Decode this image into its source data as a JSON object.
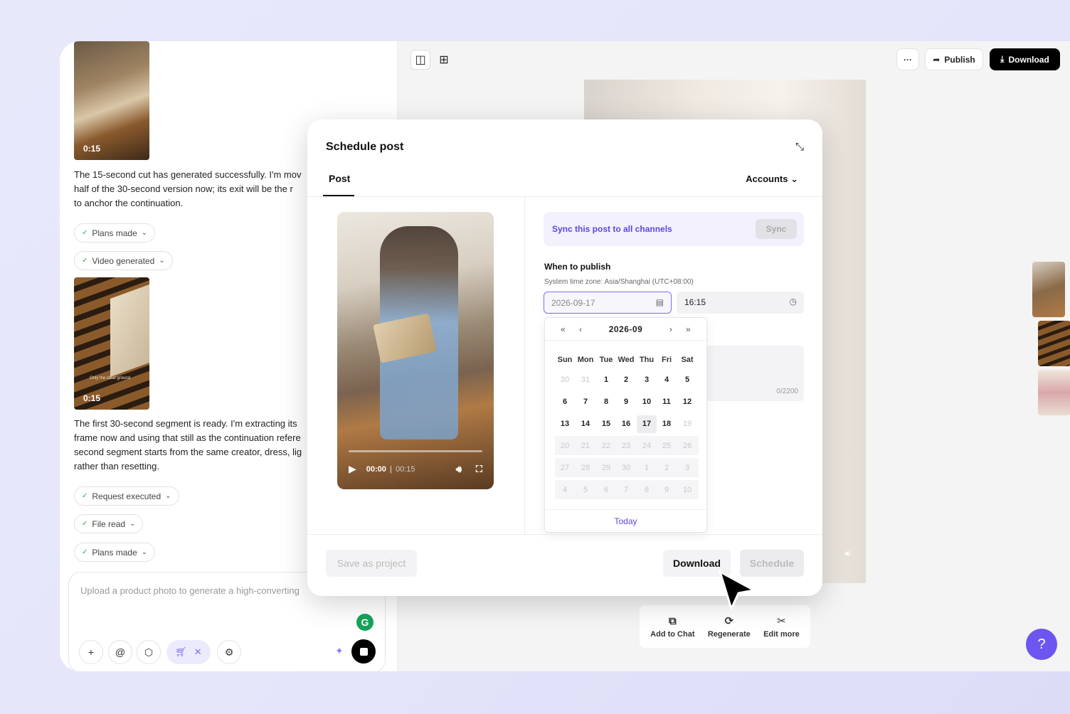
{
  "chat": {
    "thumb1_duration": "0:15",
    "para1": "The 15-second cut has generated successfully. I'm mov\nhalf of the 30-second version now; its exit will be the r\nto anchor the continuation.",
    "chip_plans_made": "Plans made",
    "chip_video_generated": "Video generated",
    "thumb2_caption": "Only the ideal ground",
    "thumb2_duration": "0:15",
    "para2": "The first 30-second segment is ready. I'm extracting its\nframe now and using that still as the continuation refere\nsecond segment starts from the same creator, dress, lig\nrather than resetting.",
    "chip_request_executed": "Request executed",
    "chip_file_read": "File read",
    "chip_plans_made_2": "Plans made",
    "composer_placeholder": "Upload a product photo to generate a high-converting",
    "grammarly": "G"
  },
  "toolbar": {
    "more": "···",
    "publish": "Publish",
    "download": "Download"
  },
  "preview_actions": {
    "add_to_chat": "Add to Chat",
    "regenerate": "Regenerate",
    "edit_more": "Edit more"
  },
  "modal": {
    "title": "Schedule post",
    "tab_post": "Post",
    "accounts": "Accounts",
    "video_time": "00:00",
    "video_duration": "00:15",
    "sync_text": "Sync this post to all channels",
    "sync_button": "Sync",
    "when_to_publish": "When to publish",
    "timezone": "System time zone: Asia/Shanghai (UTC+08:00)",
    "date_value": "2026-09-17",
    "time_value": "16:15",
    "char_count": "0/2200",
    "save_as_project": "Save as project",
    "download": "Download",
    "schedule": "Schedule"
  },
  "calendar": {
    "month_label": "2026-09",
    "weekdays": [
      "Sun",
      "Mon",
      "Tue",
      "Wed",
      "Thu",
      "Fri",
      "Sat"
    ],
    "weeks": [
      [
        "30",
        "31",
        "1",
        "2",
        "3",
        "4",
        "5"
      ],
      [
        "6",
        "7",
        "8",
        "9",
        "10",
        "11",
        "12"
      ],
      [
        "13",
        "14",
        "15",
        "16",
        "17",
        "18",
        "19"
      ],
      [
        "20",
        "21",
        "22",
        "23",
        "24",
        "25",
        "26"
      ],
      [
        "27",
        "28",
        "29",
        "30",
        "1",
        "2",
        "3"
      ],
      [
        "4",
        "5",
        "6",
        "7",
        "8",
        "9",
        "10"
      ]
    ],
    "selected_day": "17",
    "today_label": "Today"
  },
  "colors": {
    "accent": "#5b48e0",
    "help_button": "#6b56f0"
  }
}
